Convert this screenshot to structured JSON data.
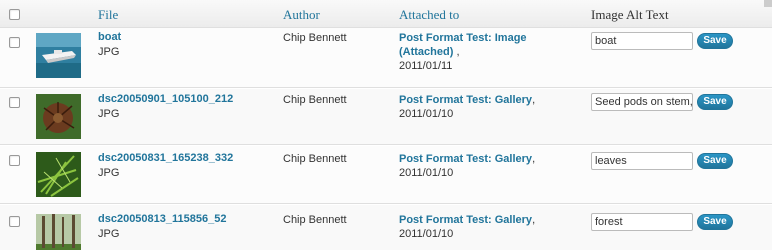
{
  "header": {
    "file": "File",
    "author": "Author",
    "attached_to": "Attached to",
    "alt_text": "Image Alt Text"
  },
  "rows": [
    {
      "file_name": "boat",
      "file_type": "JPG",
      "author": "Chip Bennett",
      "attached_title": "Post Format Test: Image (Attached)",
      "attached_suffix": " ,",
      "attached_date": "2011/01/11",
      "alt_text": "boat",
      "save_label": "Save"
    },
    {
      "file_name": "dsc20050901_105100_212",
      "file_type": "JPG",
      "author": "Chip Bennett",
      "attached_title": "Post Format Test: Gallery",
      "attached_suffix": ", 2011/01/10",
      "attached_date": "",
      "alt_text": "Seed pods on stem, Wo",
      "save_label": "Save"
    },
    {
      "file_name": "dsc20050831_165238_332",
      "file_type": "JPG",
      "author": "Chip Bennett",
      "attached_title": "Post Format Test: Gallery",
      "attached_suffix": ", 2011/01/10",
      "attached_date": "",
      "alt_text": "leaves",
      "save_label": "Save"
    },
    {
      "file_name": "dsc20050813_115856_52",
      "file_type": "JPG",
      "author": "Chip Bennett",
      "attached_title": "Post Format Test: Gallery",
      "attached_suffix": ", 2011/01/10",
      "attached_date": "",
      "alt_text": "forest",
      "save_label": "Save"
    }
  ],
  "icons": {
    "thumbnails": [
      "boat-thumbnail-icon",
      "seed-pods-thumbnail-icon",
      "leaves-thumbnail-icon",
      "forest-thumbnail-icon"
    ]
  }
}
